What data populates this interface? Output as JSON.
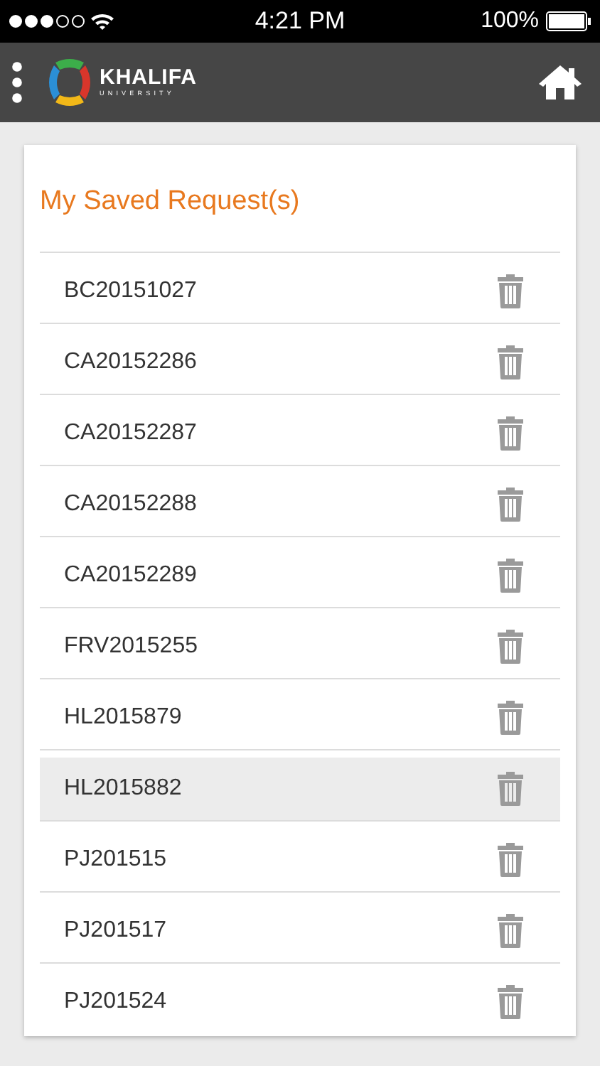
{
  "status_bar": {
    "time": "4:21 PM",
    "battery": "100%"
  },
  "app_bar": {
    "logo_name": "KHALIFA",
    "logo_subtitle": "UNIVERSITY"
  },
  "card": {
    "title": "My Saved Request(s)",
    "requests": [
      {
        "code": "BC20151027",
        "selected": false
      },
      {
        "code": "CA20152286",
        "selected": false
      },
      {
        "code": "CA20152287",
        "selected": false
      },
      {
        "code": "CA20152288",
        "selected": false
      },
      {
        "code": "CA20152289",
        "selected": false
      },
      {
        "code": "FRV2015255",
        "selected": false
      },
      {
        "code": "HL2015879",
        "selected": false
      },
      {
        "code": "HL2015882",
        "selected": true
      },
      {
        "code": "PJ201515",
        "selected": false
      },
      {
        "code": "PJ201517",
        "selected": false
      },
      {
        "code": "PJ201524",
        "selected": false
      }
    ]
  }
}
